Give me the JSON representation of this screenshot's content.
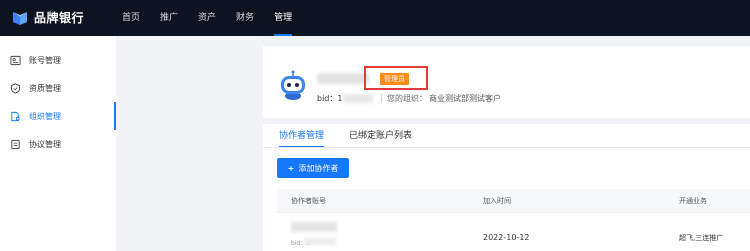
{
  "brand": {
    "name": "品牌银行"
  },
  "nav": {
    "items": [
      {
        "label": "首页",
        "active": false
      },
      {
        "label": "推广",
        "active": false
      },
      {
        "label": "资产",
        "active": false
      },
      {
        "label": "财务",
        "active": false
      },
      {
        "label": "管理",
        "active": true
      }
    ]
  },
  "sidebar": {
    "items": [
      {
        "label": "账号管理",
        "icon": "account-card-icon",
        "active": false
      },
      {
        "label": "资质管理",
        "icon": "shield-icon",
        "active": false
      },
      {
        "label": "组织管理",
        "icon": "organization-icon",
        "active": true
      },
      {
        "label": "协议管理",
        "icon": "document-icon",
        "active": false
      }
    ]
  },
  "profile": {
    "role_badge": "管理员",
    "bid_label": "bid：1",
    "org_label": "您的组织：",
    "org_value": "商业测试部测试客户"
  },
  "tabs": [
    {
      "label": "协作者管理",
      "active": true
    },
    {
      "label": "已绑定账户列表",
      "active": false
    }
  ],
  "actions": {
    "add_collaborator": "添加协作者"
  },
  "table": {
    "columns": [
      "协作者账号",
      "加入时间",
      "开通业务"
    ],
    "rows": [
      {
        "bid_prefix": "bid：1",
        "joined": "2022-10-12",
        "business": "超飞,三连推广"
      }
    ]
  },
  "colors": {
    "accent": "#1677ff",
    "badge": "#fa8c16",
    "highlight": "#e43a3a",
    "topbar": "#0d1420"
  }
}
